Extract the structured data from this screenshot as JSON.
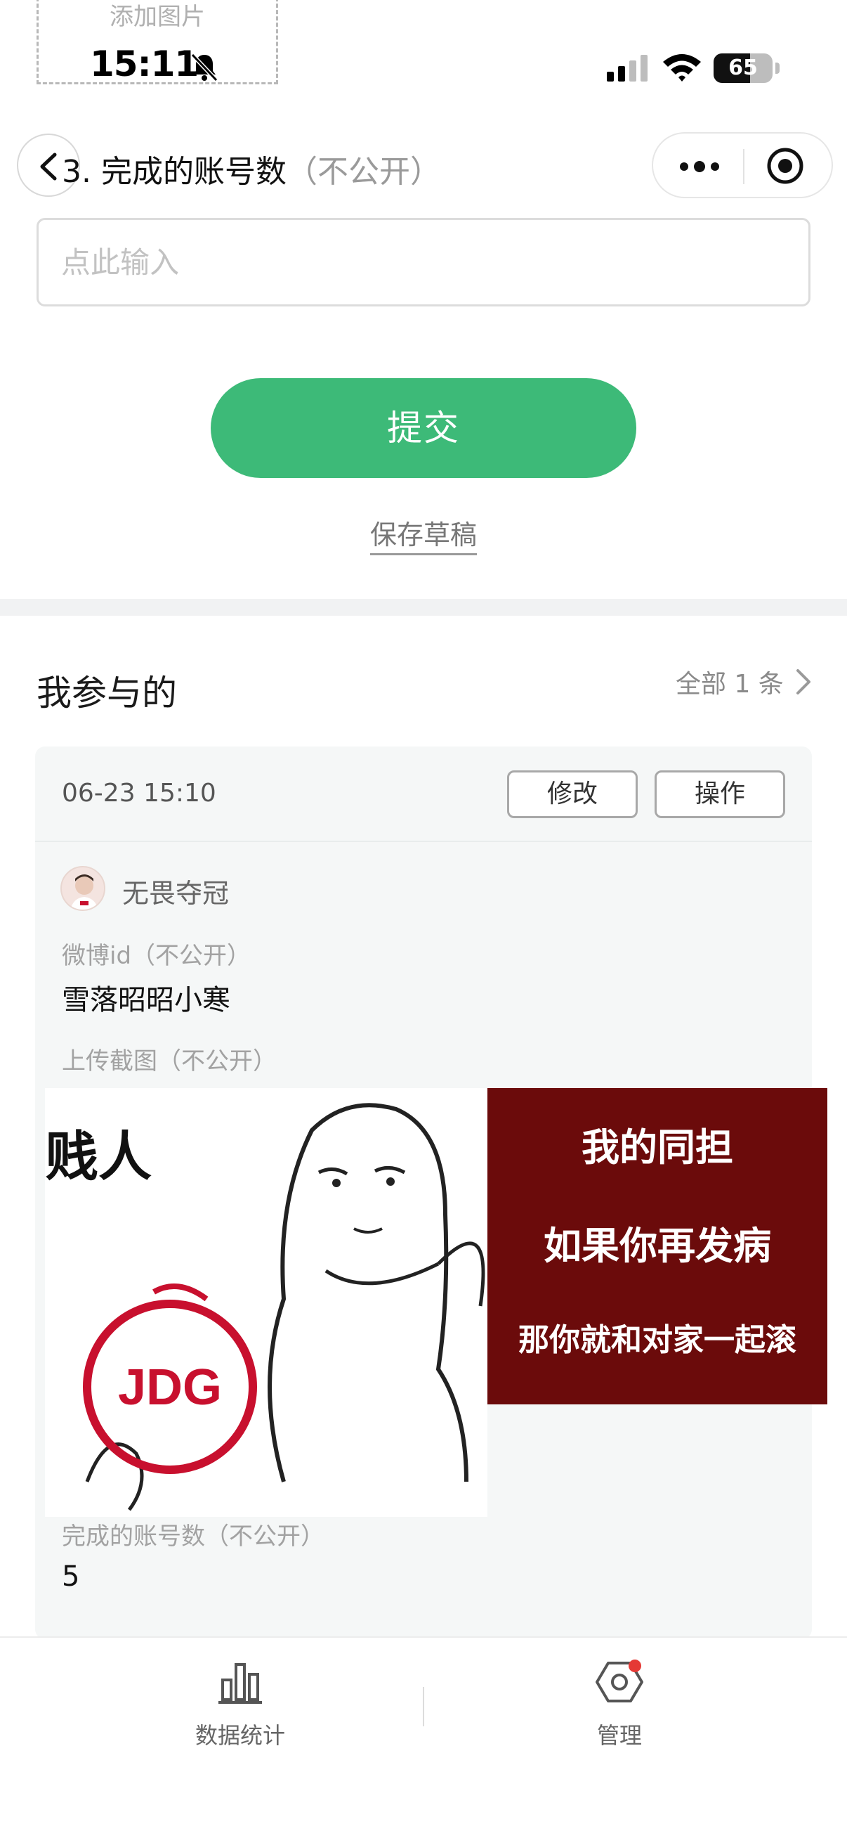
{
  "status_bar": {
    "time": "15:11",
    "battery": "65",
    "upload_ghost_label": "添加图片"
  },
  "header": {
    "question_title": "3. 完成的账号数",
    "question_hint": "（不公开）"
  },
  "form": {
    "input_placeholder": "点此输入",
    "submit_label": "提交",
    "save_draft_label": "保存草稿"
  },
  "mine": {
    "title": "我参与的",
    "all_label": "全部 1 条"
  },
  "record": {
    "time": "06-23 15:10",
    "edit_label": "修改",
    "ops_label": "操作",
    "username": "无畏夺冠",
    "fields": [
      {
        "label": "微博id（不公开）",
        "value": "雪落昭昭小寒"
      },
      {
        "label": "上传截图（不公开）",
        "value": ""
      },
      {
        "label": "完成的账号数（不公开）",
        "value": "5"
      }
    ],
    "meme": {
      "left_text": "贱人",
      "logo_text": "JDG",
      "right_lines": [
        "我的同担",
        "如果你再发病",
        "那你就和对家一起滚"
      ]
    }
  },
  "tabbar": {
    "items": [
      {
        "label": "数据统计",
        "icon": "bar-chart-icon"
      },
      {
        "label": "管理",
        "icon": "hexagon-settings-icon"
      }
    ]
  },
  "colors": {
    "accent": "#3dba78",
    "meme_bg": "#6b0b0b",
    "jdg_red": "#c8102e",
    "badge": "#e53935"
  }
}
